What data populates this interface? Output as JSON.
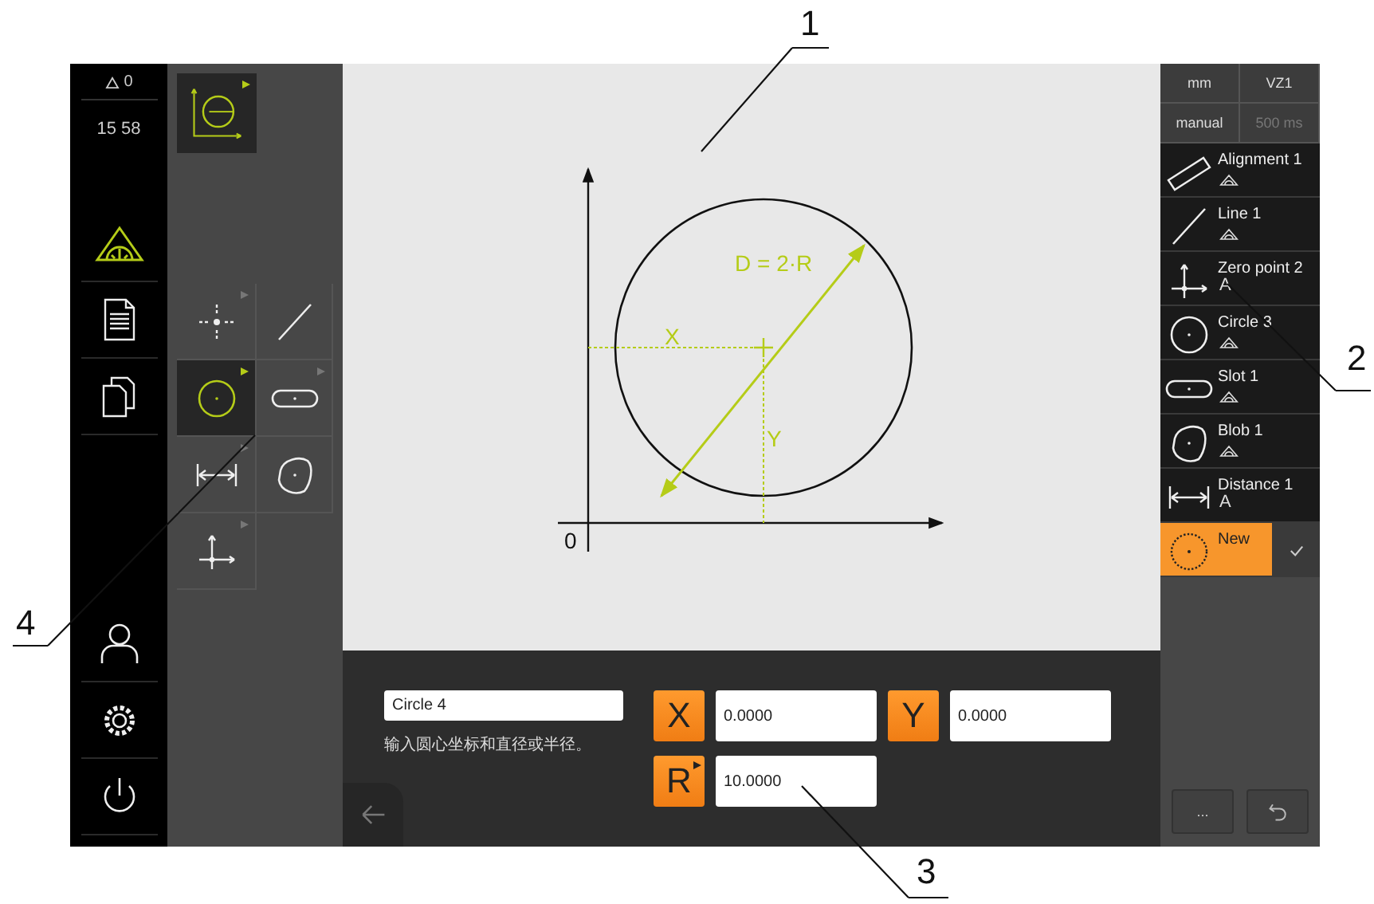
{
  "status": {
    "warnings": "0",
    "time": "15 58"
  },
  "nav": [
    {
      "kind": "measure",
      "selected": true
    },
    {
      "kind": "report",
      "selected": false
    },
    {
      "kind": "files",
      "selected": false
    },
    {
      "kind": "user",
      "selected": false
    },
    {
      "kind": "settings",
      "selected": false
    },
    {
      "kind": "power",
      "selected": false
    }
  ],
  "tool_group": {
    "selected": true
  },
  "tools": [
    {
      "kind": "point",
      "selected": false,
      "submenu": true
    },
    {
      "kind": "line",
      "selected": false,
      "submenu": false
    },
    {
      "kind": "circle",
      "selected": true,
      "submenu": true
    },
    {
      "kind": "slot",
      "selected": false,
      "submenu": true
    },
    {
      "kind": "distance",
      "selected": false,
      "submenu": true
    },
    {
      "kind": "blob",
      "selected": false,
      "submenu": false
    },
    {
      "kind": "zero_point",
      "selected": false,
      "submenu": true
    }
  ],
  "diagram": {
    "diameter_label": "D = 2·R",
    "x_label": "X",
    "y_label": "Y",
    "origin_label": "0"
  },
  "settings": [
    {
      "text": "mm",
      "disabled": false
    },
    {
      "text": "VZ1",
      "disabled": false
    },
    {
      "text": "manual",
      "disabled": false
    },
    {
      "text": "500 ms",
      "disabled": true
    }
  ],
  "features": [
    {
      "name": "Alignment 1",
      "kind": "alignment",
      "tolerance_icon": true,
      "selected": false
    },
    {
      "name": "Line 1",
      "kind": "line",
      "tolerance_icon": true,
      "selected": false
    },
    {
      "name": "Zero point 2",
      "kind": "zero_point",
      "tolerance_icon": false,
      "tag": "A",
      "selected": false
    },
    {
      "name": "Circle 3",
      "kind": "circle",
      "tolerance_icon": true,
      "selected": false
    },
    {
      "name": "Slot 1",
      "kind": "slot",
      "tolerance_icon": true,
      "selected": false
    },
    {
      "name": "Blob 1",
      "kind": "blob",
      "tolerance_icon": true,
      "selected": false
    },
    {
      "name": "Distance 1",
      "kind": "distance",
      "tolerance_icon": false,
      "tag": "A",
      "selected": false
    },
    {
      "name": "New",
      "kind": "new",
      "tolerance_icon": false,
      "selected": true
    }
  ],
  "panel_buttons": {
    "more": "..."
  },
  "input": {
    "name": "Circle 4",
    "hint": "输入圆心坐标和直径或半径。",
    "fields": [
      {
        "label": "X",
        "value": "0.0000",
        "menu": false
      },
      {
        "label": "Y",
        "value": "0.0000",
        "menu": false
      },
      {
        "label": "R",
        "value": "10.0000",
        "menu": true
      }
    ]
  },
  "callouts": [
    "1",
    "2",
    "3",
    "4"
  ]
}
